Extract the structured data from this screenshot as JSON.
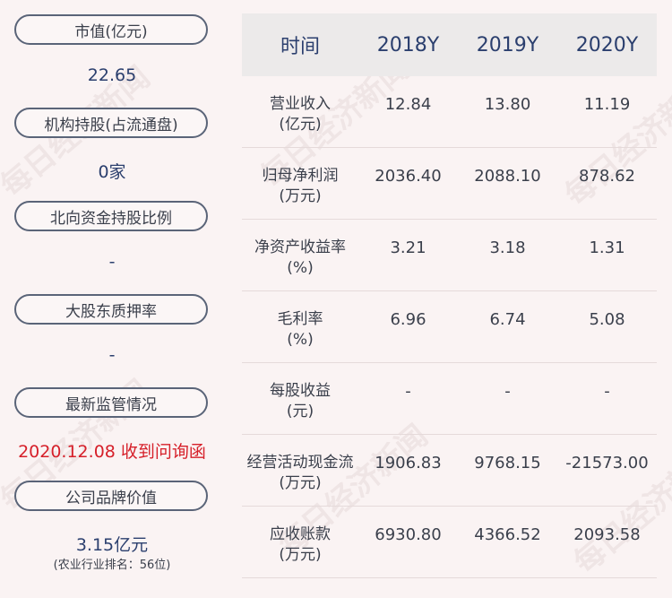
{
  "left": {
    "items": [
      {
        "label": "市值(亿元)",
        "value": "22.65"
      },
      {
        "label": "机构持股(占流通盘)",
        "value": "0家"
      },
      {
        "label": "北向资金持股比例",
        "value": "-"
      },
      {
        "label": "大股东质押率",
        "value": "-"
      },
      {
        "label": "最新监管情况",
        "value": "2020.12.08 收到问询函"
      },
      {
        "label": "公司品牌价值",
        "value": "3.15亿元",
        "note": "(农业行业排名：56位)"
      }
    ]
  },
  "table": {
    "headers": [
      "时间",
      "2018Y",
      "2019Y",
      "2020Y"
    ],
    "rows": [
      {
        "label": [
          "营业收入",
          "(亿元)"
        ],
        "values": [
          "12.84",
          "13.80",
          "11.19"
        ]
      },
      {
        "label": [
          "归母净利润",
          "(万元)"
        ],
        "values": [
          "2036.40",
          "2088.10",
          "878.62"
        ]
      },
      {
        "label": [
          "净资产收益率",
          "(%)"
        ],
        "values": [
          "3.21",
          "3.18",
          "1.31"
        ]
      },
      {
        "label": [
          "毛利率",
          "(%)"
        ],
        "values": [
          "6.96",
          "6.74",
          "5.08"
        ]
      },
      {
        "label": [
          "每股收益",
          "(元)"
        ],
        "values": [
          "-",
          "-",
          "-"
        ]
      },
      {
        "label": [
          "经营活动现金流",
          "(万元)"
        ],
        "values": [
          "1906.83",
          "9768.15",
          "-21573.00"
        ]
      },
      {
        "label": [
          "应收账款",
          "(万元)"
        ],
        "values": [
          "6930.80",
          "4366.52",
          "2093.58"
        ]
      }
    ]
  },
  "watermark": "每日经济新闻",
  "colors": {
    "accent_blue": "#2b3f6e",
    "alert_red": "#d6202a",
    "pill_border": "#5a6478"
  }
}
